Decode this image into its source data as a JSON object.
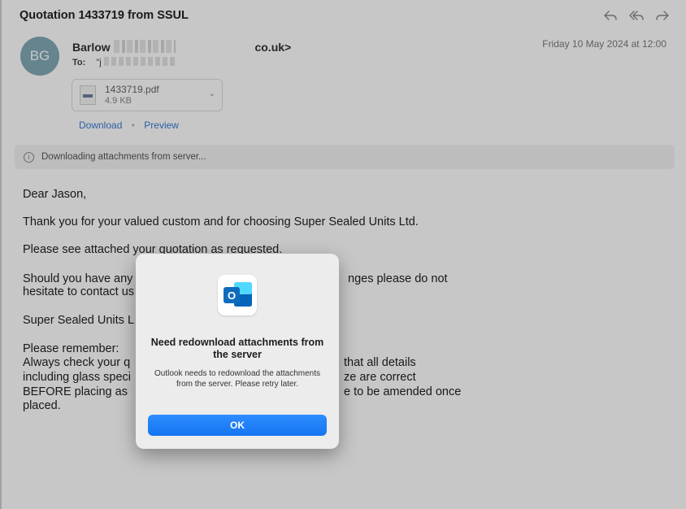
{
  "email": {
    "subject": "Quotation 1433719 from SSUL",
    "avatar_initials": "BG",
    "from_start": "Barlow",
    "from_end": "co.uk>",
    "to_label": "To:",
    "to_value": "\"j",
    "date": "Friday 10 May 2024 at 12:00",
    "attachment": {
      "name": "1433719.pdf",
      "size": "4.9 KB"
    },
    "download_label": "Download",
    "separator": "•",
    "preview_label": "Preview",
    "banner_text": "Downloading attachments from server...",
    "info_glyph": "i",
    "body": {
      "greeting": "Dear Jason,",
      "line1": "Thank you for your valued custom and for choosing Super Sealed Units Ltd.",
      "line2": "Please see attached your quotation as requested.",
      "line3a": "Should you have any",
      "line3b": "nges please do not",
      "line4": "hesitate to contact us",
      "line5": "Super Sealed Units L",
      "line6": "Please remember:",
      "line7a": "Always check your q",
      "line7b": "that all details",
      "line8a": "including glass speci",
      "line8b": "ze are correct",
      "line9a": "BEFORE placing as",
      "line9b": "e to be amended once",
      "line10": "placed."
    }
  },
  "dialog": {
    "title": "Need redownload attachments from the server",
    "message": "Outlook needs to redownload the attachments from the server. Please retry later.",
    "ok_label": "OK",
    "icon_letter": "O"
  },
  "icons": {
    "reply": "reply-icon",
    "reply_all": "reply-all-icon",
    "forward": "forward-icon",
    "app": "outlook-icon"
  },
  "colors": {
    "accent": "#1677f5",
    "avatar": "#82a9b6",
    "link": "#3a7bd5",
    "outlook_blue": "#0f6cbd"
  }
}
